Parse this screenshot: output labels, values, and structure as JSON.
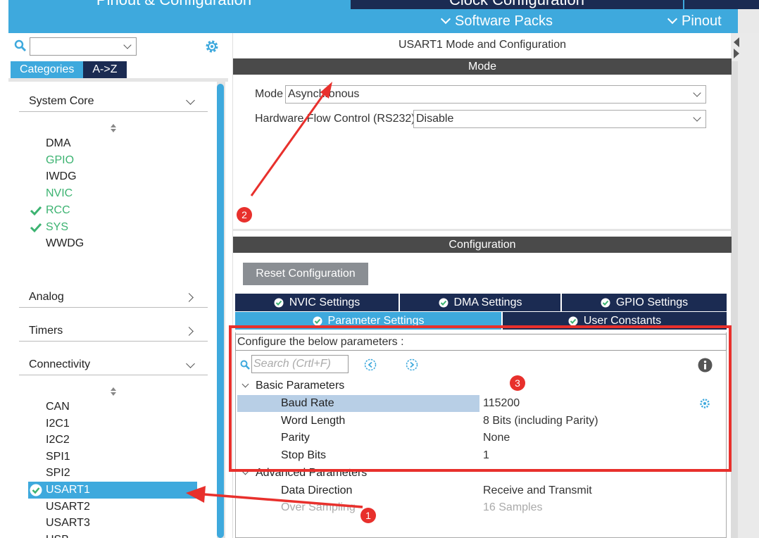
{
  "top_tabs": {
    "pinout_config": "Pinout & Configuration",
    "clock_config": "Clock Configuration"
  },
  "menu": {
    "software_packs": "Software Packs",
    "pinout": "Pinout"
  },
  "left": {
    "search_value": "",
    "tabs": [
      "Categories",
      "A->Z"
    ],
    "categories": {
      "system_core": "System Core",
      "analog": "Analog",
      "timers": "Timers",
      "connectivity": "Connectivity"
    },
    "system_core_items": [
      {
        "name": "DMA",
        "status": "none"
      },
      {
        "name": "GPIO",
        "status": "green"
      },
      {
        "name": "IWDG",
        "status": "none"
      },
      {
        "name": "NVIC",
        "status": "green"
      },
      {
        "name": "RCC",
        "status": "checked"
      },
      {
        "name": "SYS",
        "status": "checked"
      },
      {
        "name": "WWDG",
        "status": "none"
      }
    ],
    "connectivity_items": [
      {
        "name": "CAN",
        "status": "none"
      },
      {
        "name": "I2C1",
        "status": "none"
      },
      {
        "name": "I2C2",
        "status": "none"
      },
      {
        "name": "SPI1",
        "status": "none"
      },
      {
        "name": "SPI2",
        "status": "none"
      },
      {
        "name": "USART1",
        "status": "selected"
      },
      {
        "name": "USART2",
        "status": "none"
      },
      {
        "name": "USART3",
        "status": "none"
      },
      {
        "name": "USB",
        "status": "none"
      }
    ]
  },
  "right": {
    "title": "USART1 Mode and Configuration",
    "mode_header": "Mode",
    "mode_label": "Mode",
    "mode_value": "Asynchronous",
    "flow_label": "Hardware Flow Control (RS232)",
    "flow_value": "Disable",
    "config_header": "Configuration",
    "reset_button": "Reset Configuration",
    "tabs": {
      "nvic": "NVIC Settings",
      "dma": "DMA Settings",
      "gpio": "GPIO Settings",
      "parameter": "Parameter Settings",
      "user_constants": "User Constants"
    },
    "param_desc": "Configure the below parameters :",
    "search_placeholder": "Search (Crtl+F)",
    "basic_group": "Basic Parameters",
    "advanced_group": "Advanced Parameters",
    "basic_params": [
      {
        "name": "Baud Rate",
        "value": "115200"
      },
      {
        "name": "Word Length",
        "value": "8 Bits (including Parity)"
      },
      {
        "name": "Parity",
        "value": "None"
      },
      {
        "name": "Stop Bits",
        "value": "1"
      }
    ],
    "advanced_params": [
      {
        "name": "Data Direction",
        "value": "Receive and Transmit"
      },
      {
        "name": "Over Sampling",
        "value": "16 Samples"
      }
    ]
  },
  "annotations": {
    "badge_1": "1",
    "badge_2": "2",
    "badge_3": "3"
  },
  "colors": {
    "accent_blue": "#3ea9dd",
    "navy": "#1b2b52",
    "green": "#3cb371",
    "annotation_red": "#e8302c"
  }
}
